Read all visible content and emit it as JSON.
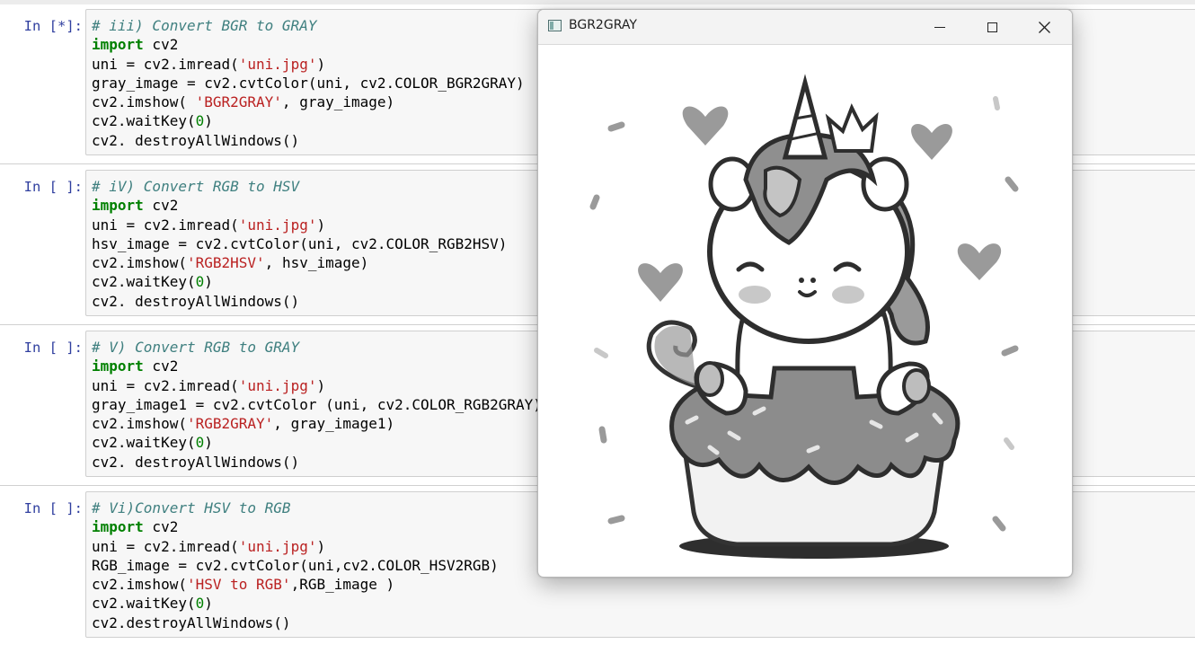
{
  "notebook": {
    "cells": [
      {
        "prompt": "In [*]:",
        "lines": [
          [
            {
              "t": "c",
              "v": "# iii) Convert BGR to GRAY"
            }
          ],
          [
            {
              "t": "k",
              "v": "import"
            },
            {
              "t": "p",
              "v": " cv2"
            }
          ],
          [
            {
              "t": "p",
              "v": "uni = cv2.imread("
            },
            {
              "t": "s",
              "v": "'uni.jpg'"
            },
            {
              "t": "p",
              "v": ")"
            }
          ],
          [
            {
              "t": "p",
              "v": "gray_image = cv2.cvtColor(uni, cv2.COLOR_BGR2GRAY)"
            }
          ],
          [
            {
              "t": "p",
              "v": "cv2.imshow( "
            },
            {
              "t": "s",
              "v": "'BGR2GRAY'"
            },
            {
              "t": "p",
              "v": ", gray_image)"
            }
          ],
          [
            {
              "t": "p",
              "v": "cv2.waitKey("
            },
            {
              "t": "n",
              "v": "0"
            },
            {
              "t": "p",
              "v": ")"
            }
          ],
          [
            {
              "t": "p",
              "v": "cv2. destroyAllWindows()"
            }
          ]
        ]
      },
      {
        "prompt": "In [ ]:",
        "lines": [
          [
            {
              "t": "c",
              "v": "# iV) Convert RGB to HSV"
            }
          ],
          [
            {
              "t": "k",
              "v": "import"
            },
            {
              "t": "p",
              "v": " cv2"
            }
          ],
          [
            {
              "t": "p",
              "v": "uni = cv2.imread("
            },
            {
              "t": "s",
              "v": "'uni.jpg'"
            },
            {
              "t": "p",
              "v": ")"
            }
          ],
          [
            {
              "t": "p",
              "v": "hsv_image = cv2.cvtColor(uni, cv2.COLOR_RGB2HSV)"
            }
          ],
          [
            {
              "t": "p",
              "v": "cv2.imshow("
            },
            {
              "t": "s",
              "v": "'RGB2HSV'"
            },
            {
              "t": "p",
              "v": ", hsv_image)"
            }
          ],
          [
            {
              "t": "p",
              "v": "cv2.waitKey("
            },
            {
              "t": "n",
              "v": "0"
            },
            {
              "t": "p",
              "v": ")"
            }
          ],
          [
            {
              "t": "p",
              "v": "cv2. destroyAllWindows()"
            }
          ]
        ]
      },
      {
        "prompt": "In [ ]:",
        "lines": [
          [
            {
              "t": "c",
              "v": "# V) Convert RGB to GRAY"
            }
          ],
          [
            {
              "t": "k",
              "v": "import"
            },
            {
              "t": "p",
              "v": " cv2"
            }
          ],
          [
            {
              "t": "p",
              "v": "uni = cv2.imread("
            },
            {
              "t": "s",
              "v": "'uni.jpg'"
            },
            {
              "t": "p",
              "v": ")"
            }
          ],
          [
            {
              "t": "p",
              "v": "gray_image1 = cv2.cvtColor (uni, cv2.COLOR_RGB2GRAY)"
            }
          ],
          [
            {
              "t": "p",
              "v": "cv2.imshow("
            },
            {
              "t": "s",
              "v": "'RGB2GRAY'"
            },
            {
              "t": "p",
              "v": ", gray_image1)"
            }
          ],
          [
            {
              "t": "p",
              "v": "cv2.waitKey("
            },
            {
              "t": "n",
              "v": "0"
            },
            {
              "t": "p",
              "v": ")"
            }
          ],
          [
            {
              "t": "p",
              "v": "cv2. destroyAllWindows()"
            }
          ]
        ]
      },
      {
        "prompt": "In [ ]:",
        "lines": [
          [
            {
              "t": "c",
              "v": "# Vi)Convert HSV to RGB"
            }
          ],
          [
            {
              "t": "k",
              "v": "import"
            },
            {
              "t": "p",
              "v": " cv2"
            }
          ],
          [
            {
              "t": "p",
              "v": "uni = cv2.imread("
            },
            {
              "t": "s",
              "v": "'uni.jpg'"
            },
            {
              "t": "p",
              "v": ")"
            }
          ],
          [
            {
              "t": "p",
              "v": "RGB_image = cv2.cvtColor(uni,cv2.COLOR_HSV2RGB)"
            }
          ],
          [
            {
              "t": "p",
              "v": "cv2.imshow("
            },
            {
              "t": "s",
              "v": "'HSV to RGB'"
            },
            {
              "t": "p",
              "v": ",RGB_image )"
            }
          ],
          [
            {
              "t": "p",
              "v": "cv2.waitKey("
            },
            {
              "t": "n",
              "v": "0"
            },
            {
              "t": "p",
              "v": ")"
            }
          ],
          [
            {
              "t": "p",
              "v": "cv2.destroyAllWindows()"
            }
          ]
        ]
      }
    ]
  },
  "window": {
    "title": "BGR2GRAY",
    "app_icon": "opencv-window-icon",
    "controls": [
      "minimize-icon",
      "maximize-icon",
      "close-icon"
    ],
    "close_glyph": "✕",
    "image_description_icon": "unicorn-on-cupcake-grayscale-image"
  },
  "colors": {
    "prompt": "#303f9f",
    "comment": "#408080",
    "keyword": "#008000",
    "string": "#ba2121",
    "number": "#008000",
    "cell_bg": "#f7f7f7",
    "cell_border": "#cfcfcf"
  }
}
